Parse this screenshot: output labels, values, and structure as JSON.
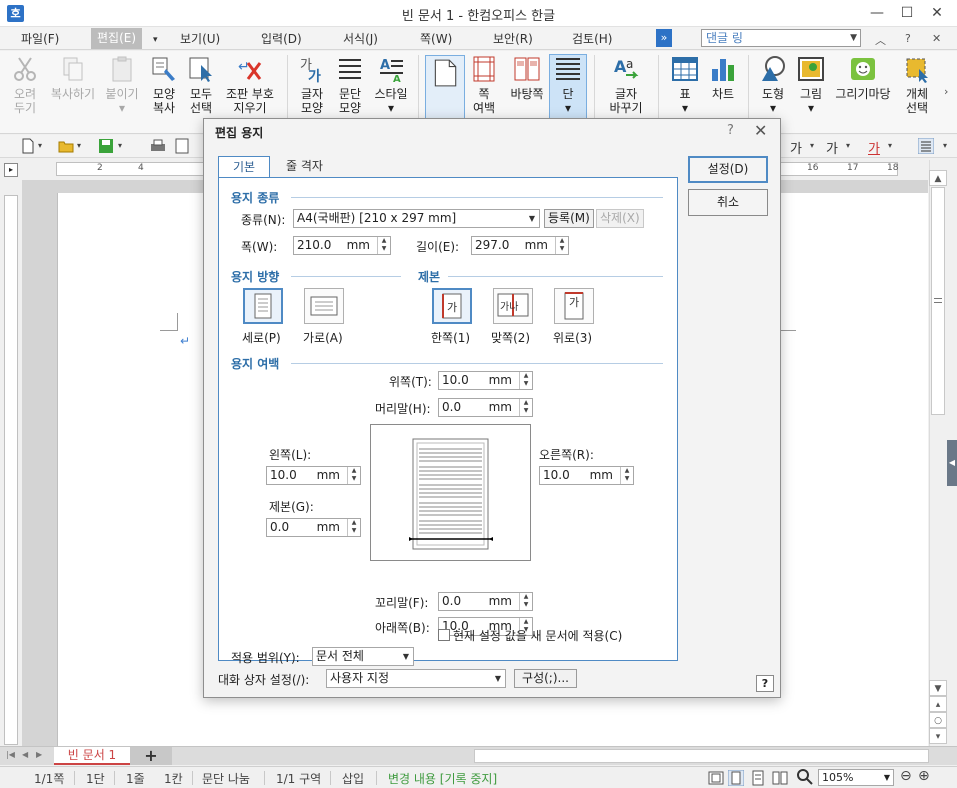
{
  "window": {
    "title": "빈 문서 1 - 한컴오피스 한글",
    "logo": "호",
    "minimize": "—",
    "maximize": "☐",
    "close": "✕"
  },
  "menu": {
    "items": [
      "파일(F)",
      "편집(E)",
      "보기(U)",
      "입력(D)",
      "서식(J)",
      "쪽(W)",
      "보안(R)",
      "검토(H)"
    ],
    "active_index": 1,
    "combo_value": "댄글 링",
    "ext": "»"
  },
  "ribbon": {
    "buttons": [
      {
        "label1": "오려",
        "label2": "두기",
        "icon": "scissors-icon",
        "disabled": true
      },
      {
        "label1": "복사하기",
        "label2": "",
        "icon": "copy-icon",
        "disabled": true
      },
      {
        "label1": "붙이기",
        "label2": "▾",
        "icon": "paste-icon",
        "disabled": true
      },
      {
        "label1": "모양",
        "label2": "복사",
        "icon": "format-painter-icon"
      },
      {
        "label1": "모두",
        "label2": "선택",
        "icon": "select-all-icon"
      },
      {
        "label1": "조판 부호",
        "label2": "지우기",
        "icon": "clear-codes-icon"
      },
      {
        "label1": "글자",
        "label2": "모양",
        "icon": "char-shape-icon"
      },
      {
        "label1": "문단",
        "label2": "모양",
        "icon": "para-shape-icon"
      },
      {
        "label1": "스타일",
        "label2": "▾",
        "icon": "style-icon"
      },
      {
        "label1": "",
        "label2": "",
        "icon": "page-icon"
      },
      {
        "label1": "쪽",
        "label2": "여백",
        "icon": "margin-icon"
      },
      {
        "label1": "바탕쪽",
        "label2": "",
        "icon": "master-page-icon"
      },
      {
        "label1": "단",
        "label2": "▾",
        "icon": "columns-icon"
      },
      {
        "label1": "글자",
        "label2": "바꾸기",
        "icon": "replace-char-icon"
      },
      {
        "label1": "표",
        "label2": "▾",
        "icon": "table-icon"
      },
      {
        "label1": "차트",
        "label2": "",
        "icon": "chart-icon"
      },
      {
        "label1": "도형",
        "label2": "▾",
        "icon": "shape-icon"
      },
      {
        "label1": "그림",
        "label2": "▾",
        "icon": "picture-icon"
      },
      {
        "label1": "그리기마당",
        "label2": "",
        "icon": "clipart-icon"
      },
      {
        "label1": "개체",
        "label2": "선택",
        "icon": "object-select-icon"
      }
    ]
  },
  "toolbar": {
    "font_glyph": "가",
    "font_glyph2": "가",
    "font_glyph3": "가"
  },
  "ruler": {
    "numbers": [
      "2",
      "4",
      "16",
      "17",
      "18"
    ]
  },
  "dialog": {
    "title": "편집 용지",
    "help": "?",
    "close": "✕",
    "tabs": [
      "기본",
      "줄 격자"
    ],
    "ok": "설정(D)",
    "cancel": "취소",
    "paper_type": {
      "section": "용지 종류",
      "type_label": "종류(N):",
      "type_value": "A4(국배판)  [210 x 297 mm]",
      "register": "등록(M)",
      "delete": "삭제(X)",
      "width_label": "폭(W):",
      "width_value": "210.0",
      "height_label": "길이(E):",
      "height_value": "297.0",
      "unit": "mm"
    },
    "orientation": {
      "section": "용지 방향",
      "portrait": "세로(P)",
      "landscape": "가로(A)"
    },
    "binding": {
      "section": "제본",
      "single": "한쪽(1)",
      "facing": "맞쪽(2)",
      "top": "위로(3)",
      "glyph_single": "가",
      "glyph_facing": "가나",
      "glyph_top": "가"
    },
    "margins": {
      "section": "용지 여백",
      "top_label": "위쪽(T):",
      "top_value": "10.0",
      "header_label": "머리말(H):",
      "header_value": "0.0",
      "left_label": "왼쪽(L):",
      "left_value": "10.0",
      "right_label": "오른쪽(R):",
      "right_value": "10.0",
      "gutter_label": "제본(G):",
      "gutter_value": "0.0",
      "footer_label": "꼬리말(F):",
      "footer_value": "0.0",
      "bottom_label": "아래쪽(B):",
      "bottom_value": "10.0"
    },
    "apply": {
      "label": "적용 범위(Y):",
      "value": "문서 전체",
      "checkbox_label": "현재 설정 값을 새 문서에 적용(C)"
    },
    "dialog_setting": {
      "label": "대화 상자 설정(/):",
      "value": "사용자 지정",
      "config": "구성(;)..."
    }
  },
  "tabbar": {
    "doc_tab": "빈 문서 1",
    "add": "+"
  },
  "status": {
    "page": "1/1쪽",
    "column": "1단",
    "line": "1줄",
    "col": "1칸",
    "break": "문단 나눔",
    "section": "1/1 구역",
    "insert": "삽입",
    "track": "변경 내용 [기록 중지]",
    "zoom": "105%"
  }
}
